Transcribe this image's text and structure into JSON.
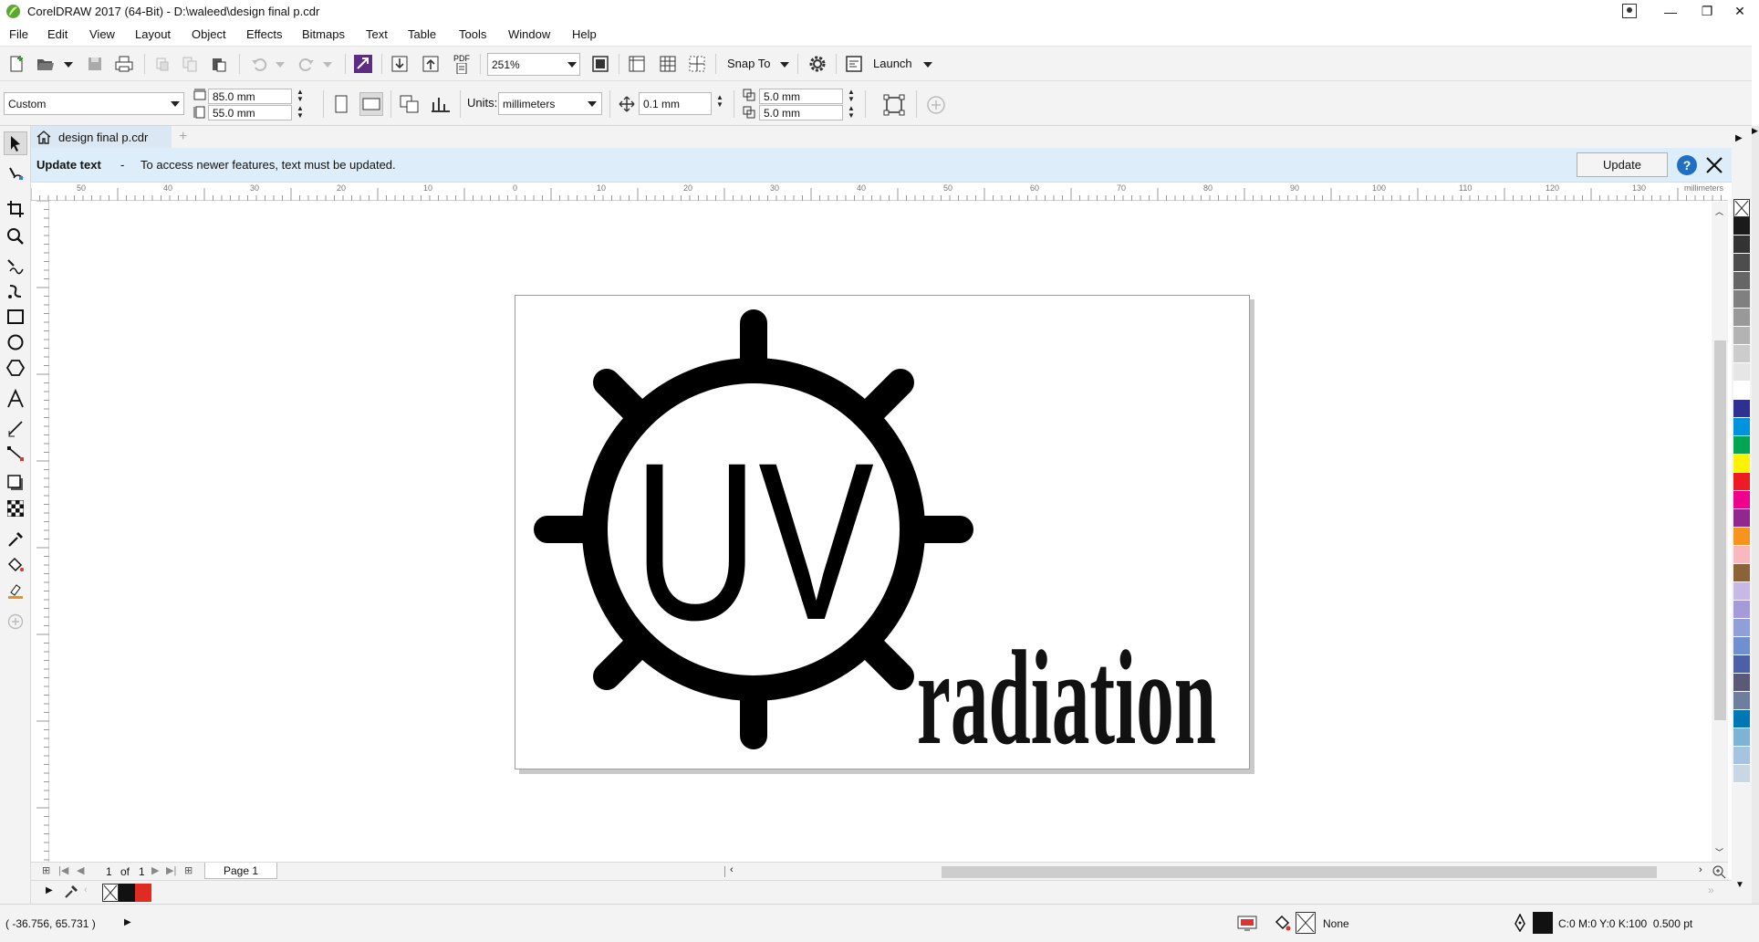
{
  "window": {
    "title": "CorelDRAW 2017 (64-Bit) - D:\\waleed\\design final p.cdr",
    "min_glyph": "—",
    "max_glyph": "❐",
    "close_glyph": "✕"
  },
  "menubar": {
    "items": [
      "File",
      "Edit",
      "View",
      "Layout",
      "Object",
      "Effects",
      "Bitmaps",
      "Text",
      "Table",
      "Tools",
      "Window",
      "Help"
    ]
  },
  "standard_toolbar": {
    "pdf_label": "PDF",
    "zoom_value": "251%",
    "snap_label": "Snap To",
    "launch_label": "Launch"
  },
  "property_bar": {
    "page_size": "Custom",
    "width": "85.0 mm",
    "height": "55.0 mm",
    "units_label": "Units:",
    "units_value": "millimeters",
    "nudge": "0.1 mm",
    "dup_x": "5.0 mm",
    "dup_y": "5.0 mm"
  },
  "document_tab": {
    "label": "design final p.cdr"
  },
  "notice": {
    "title": "Update text",
    "dash": "-",
    "message": "To access newer features, text must be updated.",
    "button": "Update",
    "help_glyph": "?"
  },
  "ruler": {
    "h_labels": [
      "50",
      "40",
      "30",
      "20",
      "10",
      "0",
      "10",
      "20",
      "30",
      "40",
      "50",
      "60",
      "70",
      "80",
      "90",
      "100",
      "110",
      "120",
      "130"
    ],
    "unit": "millimeters"
  },
  "artwork": {
    "uv_text": "UV",
    "word": "radiation"
  },
  "page_nav": {
    "current": "1",
    "of_label": "of",
    "total": "1",
    "page_tab": "Page 1"
  },
  "palette_colors": [
    "#1a1a1a",
    "#333333",
    "#4d4d4d",
    "#666666",
    "#808080",
    "#999999",
    "#b3b3b3",
    "#cccccc",
    "#e6e6e6",
    "#ffffff",
    "#2e3192",
    "#0093dd",
    "#00a651",
    "#fff200",
    "#ed1c24",
    "#ec008c",
    "#92278f",
    "#f7941d",
    "#f9b8c0",
    "#8c6239",
    "#c7b8e6",
    "#a59bd8",
    "#8fa0d8",
    "#6f8fd0",
    "#4d5fa6",
    "#5a5a78",
    "#6e7f9e",
    "#0077b5",
    "#7fb3d5",
    "#a6c4e0",
    "#c9d6e3"
  ],
  "status": {
    "coords": "( -36.756, 65.731 )",
    "fill_label": "None",
    "outline_info": "C:0 M:0 Y:0 K:100  0.500 pt"
  }
}
